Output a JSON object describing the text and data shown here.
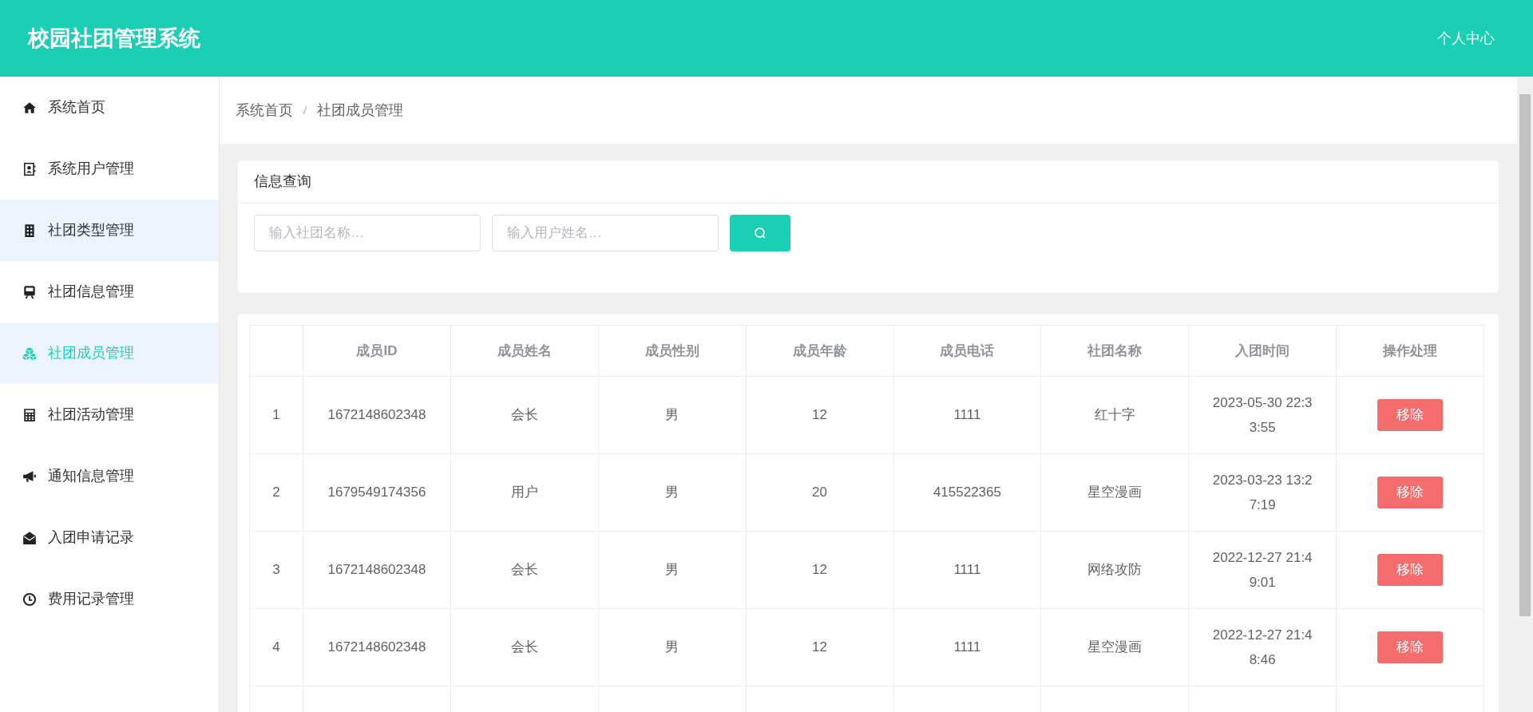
{
  "header": {
    "title": "校园社团管理系统",
    "user_menu": "个人中心"
  },
  "sidebar": {
    "items": [
      {
        "label": "系统首页",
        "selected": false,
        "hovered": false
      },
      {
        "label": "系统用户管理",
        "selected": false,
        "hovered": false
      },
      {
        "label": "社团类型管理",
        "selected": false,
        "hovered": true
      },
      {
        "label": "社团信息管理",
        "selected": false,
        "hovered": false
      },
      {
        "label": "社团成员管理",
        "selected": true,
        "hovered": false
      },
      {
        "label": "社团活动管理",
        "selected": false,
        "hovered": false
      },
      {
        "label": "通知信息管理",
        "selected": false,
        "hovered": false
      },
      {
        "label": "入团申请记录",
        "selected": false,
        "hovered": false
      },
      {
        "label": "费用记录管理",
        "selected": false,
        "hovered": false
      }
    ]
  },
  "breadcrumb": [
    "系统首页",
    "社团成员管理"
  ],
  "search_card": {
    "title": "信息查询",
    "fields": [
      {
        "placeholder": "输入社团名称…"
      },
      {
        "placeholder": "输入用户姓名…"
      }
    ]
  },
  "table": {
    "columns": [
      "",
      "成员ID",
      "成员姓名",
      "成员性别",
      "成员年龄",
      "成员电话",
      "社团名称",
      "入团时间",
      "操作处理"
    ],
    "rows": [
      {
        "cells": [
          "1",
          "1672148602348",
          "会长",
          "男",
          "12",
          "1111",
          "红十字",
          "2023-05-30 22:33:55"
        ],
        "action": "移除"
      },
      {
        "cells": [
          "2",
          "1679549174356",
          "用户",
          "男",
          "20",
          "415522365",
          "星空漫画",
          "2023-03-23 13:27:19"
        ],
        "action": "移除"
      },
      {
        "cells": [
          "3",
          "1672148602348",
          "会长",
          "男",
          "12",
          "1111",
          "网络攻防",
          "2022-12-27 21:49:01"
        ],
        "action": "移除"
      },
      {
        "cells": [
          "4",
          "1672148602348",
          "会长",
          "男",
          "12",
          "1111",
          "星空漫画",
          "2022-12-27 21:48:46"
        ],
        "action": "移除"
      }
    ]
  }
}
